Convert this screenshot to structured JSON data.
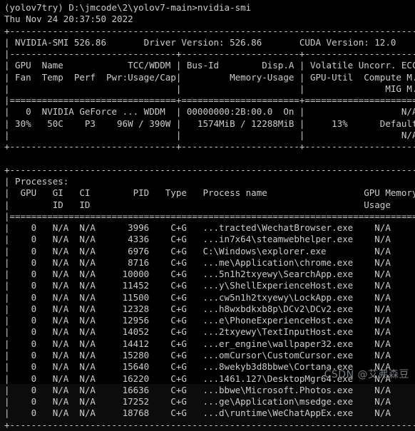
{
  "terminal": {
    "prompt_line": "(yolov7try) D:\\jmcode\\2\\yolov7-main>nvidia-smi",
    "env_name": "yolov7try",
    "working_directory": "D:\\jmcode\\2\\yolov7-main",
    "command": "nvidia-smi",
    "timestamp": "Thu Nov 24 20:37:50 2022",
    "background_color": "#000000",
    "text_color": "#cccccc"
  },
  "smi_header": {
    "smi_version_label": "NVIDIA-SMI",
    "smi_version": "526.86",
    "driver_version_label": "Driver Version:",
    "driver_version": "526.86",
    "cuda_version_label": "CUDA Version:",
    "cuda_version": "12.0"
  },
  "gpu_table": {
    "headers_row1": [
      "GPU",
      "Name",
      "TCC/WDDM",
      "Bus-Id",
      "Disp.A",
      "Volatile Uncorr. ECC"
    ],
    "headers_row2": [
      "Fan",
      "Temp",
      "Perf",
      "Pwr:Usage/Cap",
      "Memory-Usage",
      "GPU-Util",
      "Compute M."
    ],
    "headers_row3": [
      "MIG M."
    ],
    "rows": [
      {
        "gpu_index": "0",
        "name": "NVIDIA GeForce ...",
        "driver_model": "WDDM",
        "bus_id": "00000000:2B:00.0",
        "display_active": "On",
        "ecc": "N/A",
        "fan": "30%",
        "temp": "50C",
        "perf": "P3",
        "power": "96W / 390W",
        "memory": "1574MiB / 12288MiB",
        "gpu_util": "13%",
        "compute_mode": "Default",
        "mig_mode": "N/A"
      }
    ]
  },
  "processes_table": {
    "title": "Processes:",
    "headers_row1": [
      "GPU",
      "GI",
      "CI",
      "PID",
      "Type",
      "Process name",
      "GPU Memory"
    ],
    "headers_row2": [
      "ID",
      "ID",
      "Usage"
    ],
    "rows": [
      {
        "gpu": "0",
        "gi_id": "N/A",
        "ci_id": "N/A",
        "pid": "3996",
        "type": "C+G",
        "process_name": "...tracted\\WechatBrowser.exe",
        "memory_usage": "N/A"
      },
      {
        "gpu": "0",
        "gi_id": "N/A",
        "ci_id": "N/A",
        "pid": "4336",
        "type": "C+G",
        "process_name": "...in7x64\\steamwebhelper.exe",
        "memory_usage": "N/A"
      },
      {
        "gpu": "0",
        "gi_id": "N/A",
        "ci_id": "N/A",
        "pid": "6976",
        "type": "C+G",
        "process_name": "C:\\Windows\\explorer.exe",
        "memory_usage": "N/A"
      },
      {
        "gpu": "0",
        "gi_id": "N/A",
        "ci_id": "N/A",
        "pid": "8716",
        "type": "C+G",
        "process_name": "...me\\Application\\chrome.exe",
        "memory_usage": "N/A"
      },
      {
        "gpu": "0",
        "gi_id": "N/A",
        "ci_id": "N/A",
        "pid": "10000",
        "type": "C+G",
        "process_name": "...5n1h2txyewy\\SearchApp.exe",
        "memory_usage": "N/A"
      },
      {
        "gpu": "0",
        "gi_id": "N/A",
        "ci_id": "N/A",
        "pid": "11452",
        "type": "C+G",
        "process_name": "...y\\ShellExperienceHost.exe",
        "memory_usage": "N/A"
      },
      {
        "gpu": "0",
        "gi_id": "N/A",
        "ci_id": "N/A",
        "pid": "11500",
        "type": "C+G",
        "process_name": "...cw5n1h2txyewy\\LockApp.exe",
        "memory_usage": "N/A"
      },
      {
        "gpu": "0",
        "gi_id": "N/A",
        "ci_id": "N/A",
        "pid": "12328",
        "type": "C+G",
        "process_name": "...h8wxbdkxb8p\\DCv2\\DCv2.exe",
        "memory_usage": "N/A"
      },
      {
        "gpu": "0",
        "gi_id": "N/A",
        "ci_id": "N/A",
        "pid": "12956",
        "type": "C+G",
        "process_name": "...e\\PhoneExperienceHost.exe",
        "memory_usage": "N/A"
      },
      {
        "gpu": "0",
        "gi_id": "N/A",
        "ci_id": "N/A",
        "pid": "14052",
        "type": "C+G",
        "process_name": "...2txyewy\\TextInputHost.exe",
        "memory_usage": "N/A"
      },
      {
        "gpu": "0",
        "gi_id": "N/A",
        "ci_id": "N/A",
        "pid": "14412",
        "type": "C+G",
        "process_name": "...er_engine\\wallpaper32.exe",
        "memory_usage": "N/A"
      },
      {
        "gpu": "0",
        "gi_id": "N/A",
        "ci_id": "N/A",
        "pid": "15280",
        "type": "C+G",
        "process_name": "...omCursor\\CustomCursor.exe",
        "memory_usage": "N/A"
      },
      {
        "gpu": "0",
        "gi_id": "N/A",
        "ci_id": "N/A",
        "pid": "15640",
        "type": "C+G",
        "process_name": "...8wekyb3d8bbwe\\Cortana.exe",
        "memory_usage": "N/A"
      },
      {
        "gpu": "0",
        "gi_id": "N/A",
        "ci_id": "N/A",
        "pid": "16220",
        "type": "C+G",
        "process_name": "...1461.127\\DesktopMgr64.exe",
        "memory_usage": "N/A"
      },
      {
        "gpu": "0",
        "gi_id": "N/A",
        "ci_id": "N/A",
        "pid": "16636",
        "type": "C+G",
        "process_name": "...bbwe\\Microsoft.Photos.exe",
        "memory_usage": "N/A"
      },
      {
        "gpu": "0",
        "gi_id": "N/A",
        "ci_id": "N/A",
        "pid": "17252",
        "type": "C+G",
        "process_name": "...ge\\Application\\msedge.exe",
        "memory_usage": "N/A"
      },
      {
        "gpu": "0",
        "gi_id": "N/A",
        "ci_id": "N/A",
        "pid": "18768",
        "type": "C+G",
        "process_name": "...d\\runtime\\WeChatAppEx.exe",
        "memory_usage": "N/A"
      }
    ]
  },
  "rendered_lines": [
    "(yolov7try) D:\\jmcode\\2\\yolov7-main>nvidia-smi",
    "Thu Nov 24 20:37:50 2022",
    "+-----------------------------------------------------------------------------+",
    "| NVIDIA-SMI 526.86       Driver Version: 526.86       CUDA Version: 12.0     |",
    "|-------------------------------+----------------------+----------------------+",
    "| GPU  Name            TCC/WDDM | Bus-Id        Disp.A | Volatile Uncorr. ECC |",
    "| Fan  Temp  Perf  Pwr:Usage/Cap|         Memory-Usage | GPU-Util  Compute M. |",
    "|                               |                      |               MIG M. |",
    "|===============================+======================+======================|",
    "|   0  NVIDIA GeForce ... WDDM  | 00000000:2B:00.0  On |                  N/A |",
    "| 30%   50C    P3    96W / 390W |   1574MiB / 12288MiB |     13%      Default |",
    "|                               |                      |                  N/A |",
    "+-------------------------------+----------------------+----------------------+",
    "",
    "+-----------------------------------------------------------------------------+",
    "| Processes:                                                                  |",
    "|  GPU   GI   CI        PID   Type   Process name                  GPU Memory |",
    "|        ID   ID                                                   Usage      |",
    "|=============================================================================|",
    "|    0   N/A  N/A      3996    C+G   ...tracted\\WechatBrowser.exe    N/A      |",
    "|    0   N/A  N/A      4336    C+G   ...in7x64\\steamwebhelper.exe    N/A      |",
    "|    0   N/A  N/A      6976    C+G   C:\\Windows\\explorer.exe         N/A      |",
    "|    0   N/A  N/A      8716    C+G   ...me\\Application\\chrome.exe    N/A      |",
    "|    0   N/A  N/A     10000    C+G   ...5n1h2txyewy\\SearchApp.exe    N/A      |",
    "|    0   N/A  N/A     11452    C+G   ...y\\ShellExperienceHost.exe    N/A      |",
    "|    0   N/A  N/A     11500    C+G   ...cw5n1h2txyewy\\LockApp.exe    N/A      |",
    "|    0   N/A  N/A     12328    C+G   ...h8wxbdkxb8p\\DCv2\\DCv2.exe    N/A      |",
    "|    0   N/A  N/A     12956    C+G   ...e\\PhoneExperienceHost.exe    N/A      |",
    "|    0   N/A  N/A     14052    C+G   ...2txyewy\\TextInputHost.exe    N/A      |",
    "|    0   N/A  N/A     14412    C+G   ...er_engine\\wallpaper32.exe    N/A      |",
    "|    0   N/A  N/A     15280    C+G   ...omCursor\\CustomCursor.exe    N/A      |",
    "|    0   N/A  N/A     15640    C+G   ...8wekyb3d8bbwe\\Cortana.exe    N/A      |",
    "|    0   N/A  N/A     16220    C+G   ...1461.127\\DesktopMgr64.exe    N/A      |",
    "|    0   N/A  N/A     16636    C+G   ...bbwe\\Microsoft.Photos.exe    N/A      |",
    "|    0   N/A  N/A     17252    C+G   ...ge\\Application\\msedge.exe    N/A      |",
    "|    0   N/A  N/A     18768    C+G   ...d\\runtime\\WeChatAppEx.exe    N/A      |",
    "+-----------------------------------------------------------------------------+"
  ],
  "watermark": {
    "text": "CSDN @艾弗森豆"
  }
}
